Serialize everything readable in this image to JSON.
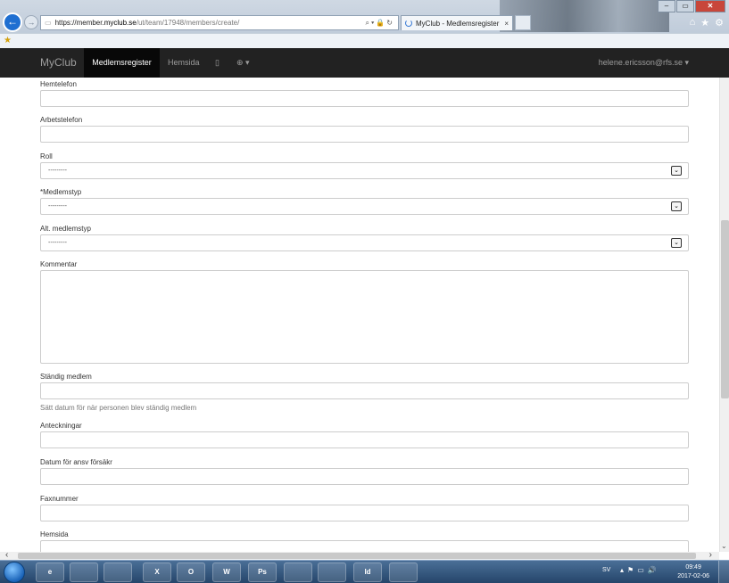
{
  "browser": {
    "url_prefix": "https://member.",
    "url_host": "myclub.se",
    "url_path": "/ut/team/17948/members/create/",
    "tab_title": "MyClub - Medlemsregister"
  },
  "navbar": {
    "brand": "MyClub",
    "items": [
      {
        "label": "Medlemsregister"
      },
      {
        "label": "Hemsida"
      }
    ],
    "mobile_icon": "▯",
    "globe_icon": "⊕ ▾",
    "user": "helene.ericsson@rfs.se ▾"
  },
  "form": {
    "hemtelefon_label": "Hemtelefon",
    "arbetstelefon_label": "Arbetstelefon",
    "roll_label": "Roll",
    "roll_value": "---------",
    "medlemstyp_label": "*Medlemstyp",
    "medlemstyp_value": "---------",
    "alt_medlemstyp_label": "Alt. medlemstyp",
    "alt_medlemstyp_value": "---------",
    "kommentar_label": "Kommentar",
    "standig_medlem_label": "Ständig medlem",
    "standig_medlem_help": "Sätt datum för när personen blev ständig medlem",
    "anteckningar_label": "Anteckningar",
    "datum_ansv_label": "Datum för ansv försäkr",
    "faxnummer_label": "Faxnummer",
    "hemsida_label": "Hemsida"
  },
  "taskbar": {
    "apps": [
      "e",
      "",
      "",
      "X",
      "O",
      "W",
      "Ps",
      "",
      "",
      "Id",
      ""
    ],
    "language": "SV",
    "time": "09:49",
    "date": "2017-02-06"
  }
}
